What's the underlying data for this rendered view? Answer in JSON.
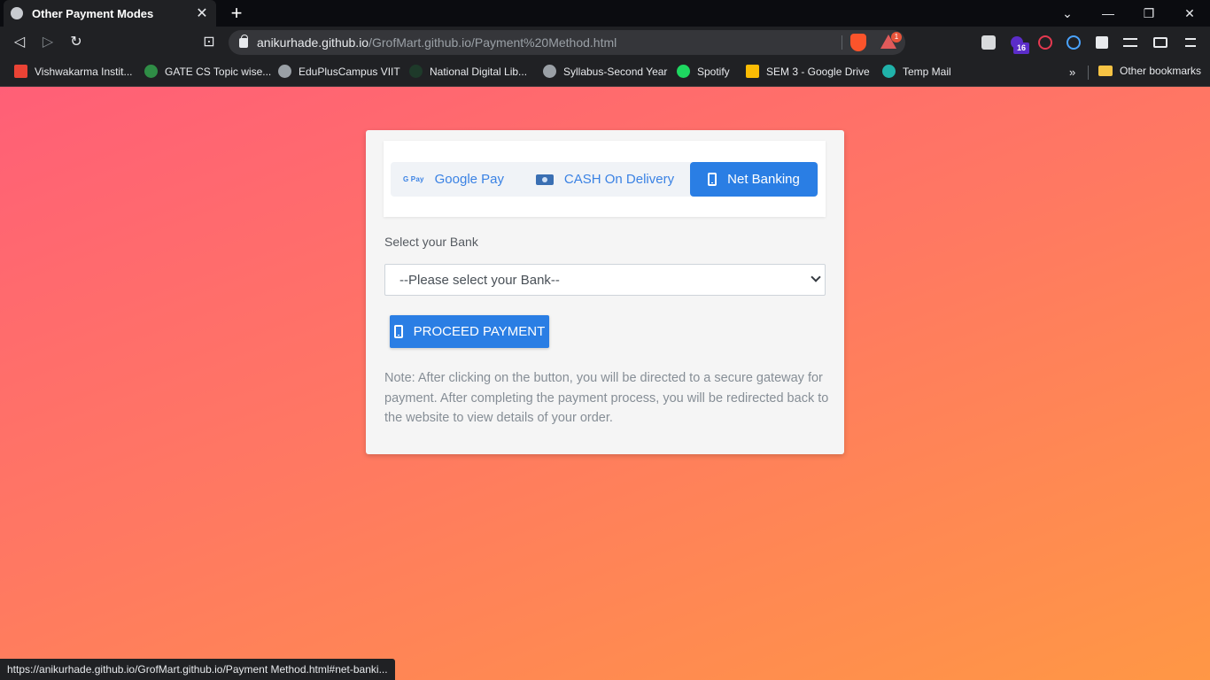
{
  "browser": {
    "tab_title": "Other Payment Modes",
    "tab_close": "✕",
    "new_tab": "+",
    "window_controls": [
      "⌄",
      "—",
      "❐",
      "✕"
    ],
    "nav": {
      "back": "◁",
      "forward": "▷",
      "reload": "↻",
      "bookmark": "⊡"
    },
    "url_host": "anikurhade.github.io",
    "url_path": "/GrofMart.github.io/Payment%20Method.html",
    "bat_badge": "1",
    "extension_badge": "16",
    "bookmarks": [
      {
        "label": "Vishwakarma Instit...",
        "color": "#ea4335"
      },
      {
        "label": "GATE CS Topic wise...",
        "color": "#2f8d46"
      },
      {
        "label": "EduPlusCampus VIIT",
        "color": "#9aa0a6"
      },
      {
        "label": "National Digital Lib...",
        "color": "#1e3a2a"
      },
      {
        "label": "Syllabus-Second Year",
        "color": "#9aa0a6"
      },
      {
        "label": "Spotify",
        "color": "#1ed760"
      },
      {
        "label": "SEM 3 - Google Drive",
        "color": "#fbbc04"
      },
      {
        "label": "Temp Mail",
        "color": "#20b2aa"
      }
    ],
    "bookmarks_more": "»",
    "other_bookmarks": "Other bookmarks",
    "status_url": "https://anikurhade.github.io/GrofMart.github.io/Payment Method.html#net-banki..."
  },
  "payment": {
    "tabs": [
      {
        "label": "Google Pay",
        "icon": "google-pay-icon",
        "icon_text": "G Pay",
        "active": false
      },
      {
        "label": "CASH On Delivery",
        "icon": "cash-icon",
        "active": false
      },
      {
        "label": "Net Banking",
        "icon": "mobile-phone-icon",
        "active": true
      }
    ],
    "select_label": "Select your Bank",
    "select_value": "--Please select your Bank--",
    "proceed_label": "PROCEED PAYMENT",
    "note": "Note: After clicking on the button, you will be directed to a secure gateway for payment. After completing the payment process, you will be redirected back to the website to view details of your order."
  },
  "colors": {
    "accent": "#2a7ee4",
    "gradient_start": "#ff5f77",
    "gradient_end": "#ff9745"
  }
}
